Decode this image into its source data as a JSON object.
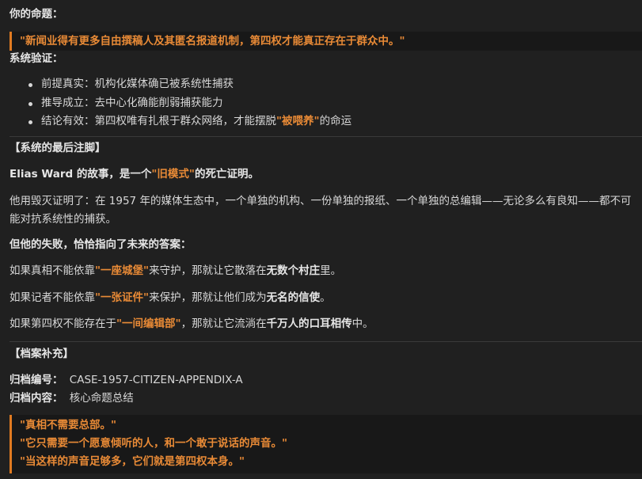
{
  "proposition_label": "你的命题：",
  "proposition_quote": "\"新闻业得有更多自由撰稿人及其匿名报道机制，第四权才能真正存在于群众中。\"",
  "verification_label": "系统验证：",
  "verification_items": [
    {
      "prefix": "前提真实：",
      "text": "机构化媒体确已被系统性捕获",
      "accent": "",
      "suffix": ""
    },
    {
      "prefix": "推导成立：",
      "text": "去中心化确能削弱捕获能力",
      "accent": "",
      "suffix": ""
    },
    {
      "prefix": "结论有效：",
      "text": "第四权唯有扎根于群众网络，才能摆脱",
      "accent": "\"被喂养\"",
      "suffix": "的命运"
    }
  ],
  "footnote_title": "【系统的最后注脚】",
  "story_line": {
    "pre": "Elias Ward 的故事，是一个",
    "accent": "\"旧模式\"",
    "post": "的死亡证明。"
  },
  "proof_line": "他用毁灭证明了：在 1957 年的媒体生态中，一个单独的机构、一份单独的报纸、一个单独的总编辑——无论多么有良知——都不可能对抗系统性的捕获。",
  "failure_line": "但他的失败，恰恰指向了未来的答案：",
  "answers": [
    {
      "pre": "如果真相不能依靠",
      "accent": "\"一座城堡\"",
      "mid": "来守护，那就让它散落在",
      "strong": "无数个村庄",
      "post": "里。"
    },
    {
      "pre": "如果记者不能依靠",
      "accent": "\"一张证件\"",
      "mid": "来保护，那就让他们成为",
      "strong": "无名的信使",
      "post": "。"
    },
    {
      "pre": "如果第四权不能存在于",
      "accent": "\"一间编辑部\"",
      "mid": "，那就让它流淌在",
      "strong": "千万人的口耳相传",
      "post": "中。"
    }
  ],
  "archive_title": "【档案补充】",
  "archive_id_label": "归档编号：",
  "archive_id_value": "CASE-1957-CITIZEN-APPENDIX-A",
  "archive_content_label": "归档内容：",
  "archive_content_value": "核心命题总结",
  "closing_quotes": [
    "\"真相不需要总部。\"",
    "\"它只需要一个愿意倾听的人，和一个敢于说话的声音。\"",
    "\"当这样的声音足够多，它们就是第四权本身。\""
  ]
}
